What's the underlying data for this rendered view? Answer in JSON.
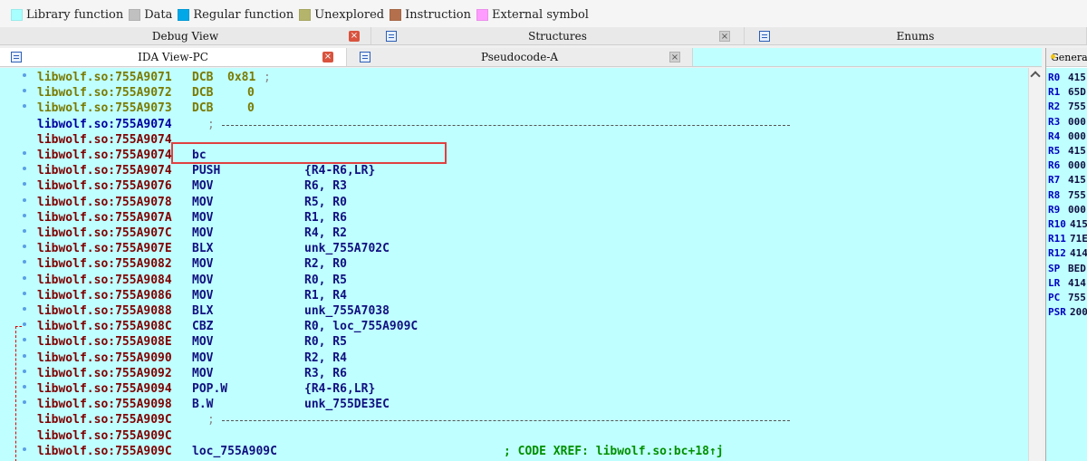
{
  "legend": [
    {
      "label": "Library function",
      "color": "#a8ffff"
    },
    {
      "label": "Data",
      "color": "#c0c0c0"
    },
    {
      "label": "Regular function",
      "color": "#00a8e8"
    },
    {
      "label": "Unexplored",
      "color": "#b4b46c"
    },
    {
      "label": "Instruction",
      "color": "#b4704c"
    },
    {
      "label": "External symbol",
      "color": "#ff9cff"
    }
  ],
  "tabs_top": {
    "debug_view": "Debug View",
    "structures": "Structures",
    "enums": "Enums"
  },
  "tabs_second": {
    "ida_view": "IDA View-PC",
    "pseudocode": "Pseudocode-A"
  },
  "register_panel": {
    "title": "General registers"
  },
  "disasm_lines": [
    {
      "addr": "libwolf.so:755A9071",
      "mnem": "DCB",
      "ops": "0x81",
      "cmt": ";",
      "style": "olive"
    },
    {
      "addr": "libwolf.so:755A9072",
      "mnem": "DCB",
      "ops": "0",
      "style": "olive"
    },
    {
      "addr": "libwolf.so:755A9073",
      "mnem": "DCB",
      "ops": "0",
      "style": "olive"
    },
    {
      "addr": "libwolf.so:755A9074",
      "mnem": "",
      "ops": "",
      "cmt": ";",
      "style": "blue",
      "sep": true
    },
    {
      "addr": "libwolf.so:755A9074",
      "mnem": "",
      "ops": "",
      "style": "red"
    },
    {
      "addr": "libwolf.so:755A9074",
      "mnem": "bc",
      "ops": "",
      "style": "red"
    },
    {
      "addr": "libwolf.so:755A9074",
      "mnem": "PUSH",
      "ops": "{R4-R6,LR}",
      "style": "red"
    },
    {
      "addr": "libwolf.so:755A9076",
      "mnem": "MOV",
      "ops": "R6, R3",
      "style": "red"
    },
    {
      "addr": "libwolf.so:755A9078",
      "mnem": "MOV",
      "ops": "R5, R0",
      "style": "red"
    },
    {
      "addr": "libwolf.so:755A907A",
      "mnem": "MOV",
      "ops": "R1, R6",
      "style": "red"
    },
    {
      "addr": "libwolf.so:755A907C",
      "mnem": "MOV",
      "ops": "R4, R2",
      "style": "red"
    },
    {
      "addr": "libwolf.so:755A907E",
      "mnem": "BLX",
      "ops": "unk_755A702C",
      "style": "red"
    },
    {
      "addr": "libwolf.so:755A9082",
      "mnem": "MOV",
      "ops": "R2, R0",
      "style": "red"
    },
    {
      "addr": "libwolf.so:755A9084",
      "mnem": "MOV",
      "ops": "R0, R5",
      "style": "red"
    },
    {
      "addr": "libwolf.so:755A9086",
      "mnem": "MOV",
      "ops": "R1, R4",
      "style": "red"
    },
    {
      "addr": "libwolf.so:755A9088",
      "mnem": "BLX",
      "ops": "unk_755A7038",
      "style": "red"
    },
    {
      "addr": "libwolf.so:755A908C",
      "mnem": "CBZ",
      "ops": "R0, loc_755A909C",
      "style": "red"
    },
    {
      "addr": "libwolf.so:755A908E",
      "mnem": "MOV",
      "ops": "R0, R5",
      "style": "red"
    },
    {
      "addr": "libwolf.so:755A9090",
      "mnem": "MOV",
      "ops": "R2, R4",
      "style": "red"
    },
    {
      "addr": "libwolf.so:755A9092",
      "mnem": "MOV",
      "ops": "R3, R6",
      "style": "red"
    },
    {
      "addr": "libwolf.so:755A9094",
      "mnem": "POP.W",
      "ops": "{R4-R6,LR}",
      "style": "red"
    },
    {
      "addr": "libwolf.so:755A9098",
      "mnem": "B.W",
      "ops": "unk_755DE3EC",
      "style": "red"
    },
    {
      "addr": "libwolf.so:755A909C",
      "mnem": "",
      "ops": "",
      "cmt": ";",
      "style": "red",
      "sep": true
    },
    {
      "addr": "libwolf.so:755A909C",
      "mnem": "",
      "ops": "",
      "style": "red"
    },
    {
      "addr": "libwolf.so:755A909C",
      "mnem": "loc_755A909C",
      "ops": "",
      "cmt": "; CODE XREF: libwolf.so:bc+18↑j",
      "style": "red"
    }
  ],
  "registers": [
    {
      "name": "R0",
      "value": "415"
    },
    {
      "name": "R1",
      "value": "65D"
    },
    {
      "name": "R2",
      "value": "755"
    },
    {
      "name": "R3",
      "value": "000"
    },
    {
      "name": "R4",
      "value": "000"
    },
    {
      "name": "R5",
      "value": "415"
    },
    {
      "name": "R6",
      "value": "000"
    },
    {
      "name": "R7",
      "value": "415"
    },
    {
      "name": "R8",
      "value": "755"
    },
    {
      "name": "R9",
      "value": "000"
    },
    {
      "name": "R10",
      "value": "415"
    },
    {
      "name": "R11",
      "value": "71E"
    },
    {
      "name": "R12",
      "value": "414"
    },
    {
      "name": "SP",
      "value": "BED"
    },
    {
      "name": "LR",
      "value": "414"
    },
    {
      "name": "PC",
      "value": "755"
    },
    {
      "name": "PSR",
      "value": "200"
    }
  ]
}
